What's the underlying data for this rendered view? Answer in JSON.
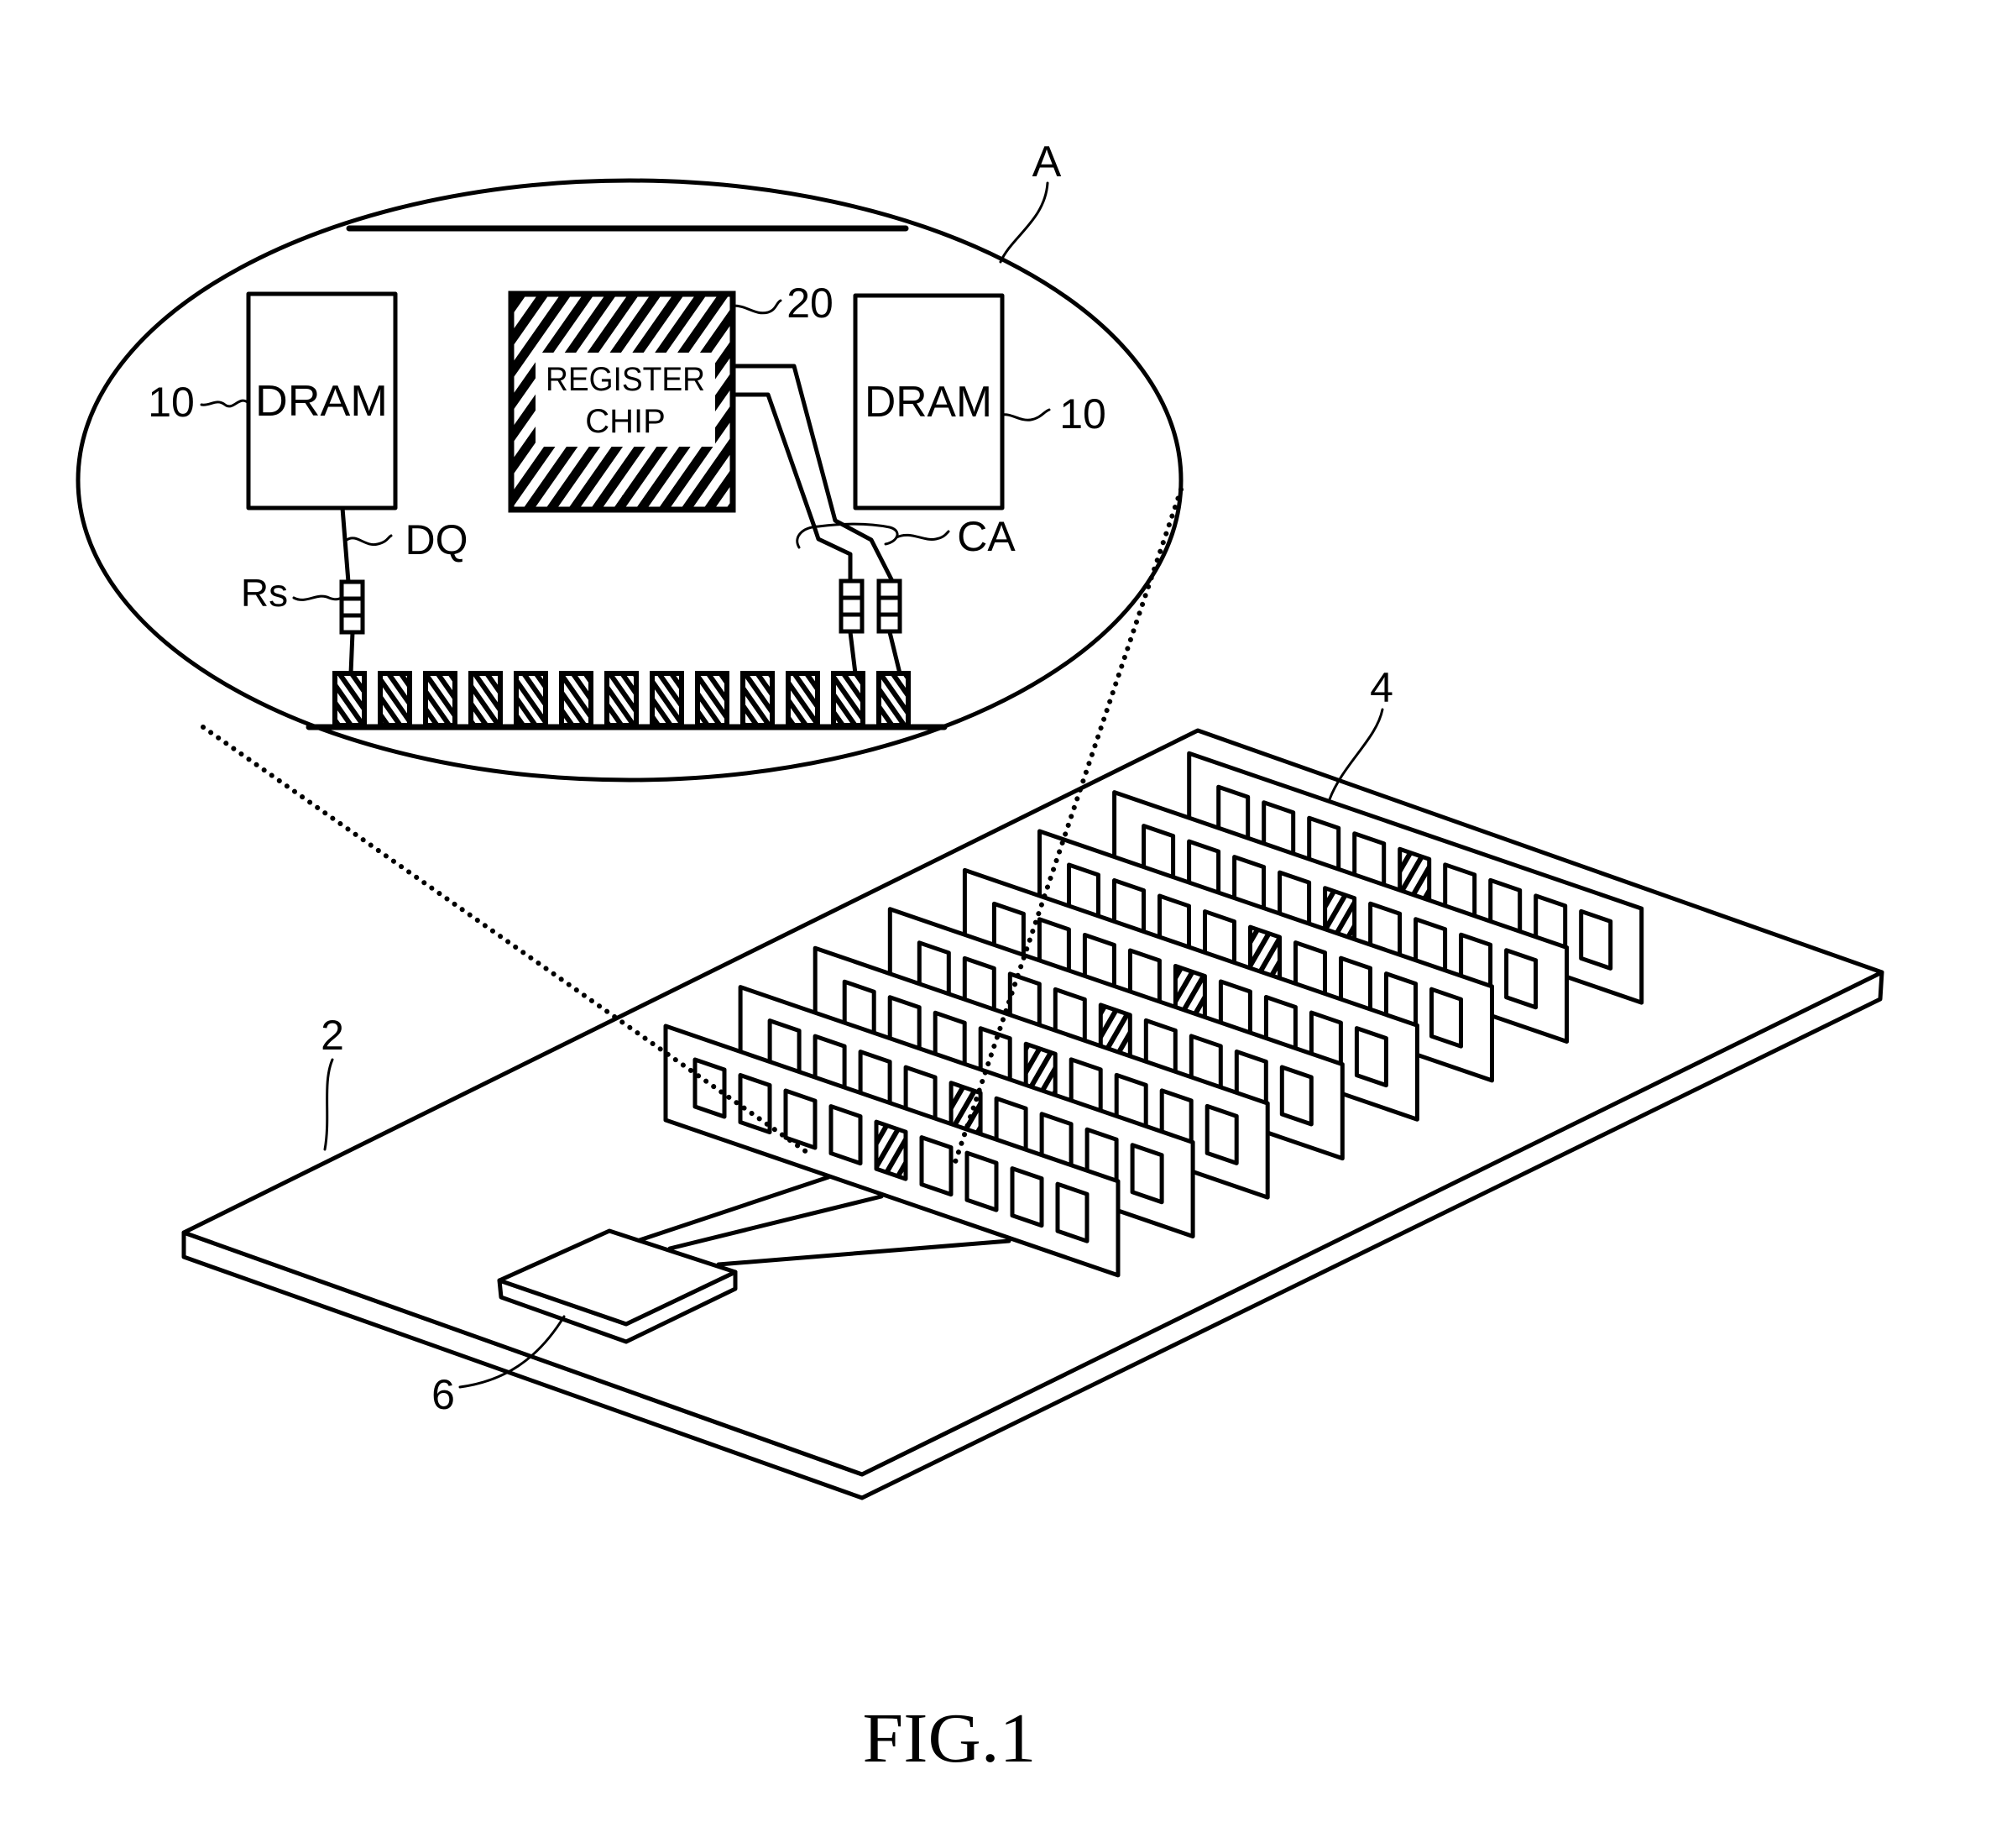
{
  "figure": {
    "caption": "FIG.1",
    "colors": {
      "ink": "#000000",
      "paper": "#ffffff"
    }
  },
  "callout": {
    "label": "A",
    "left_dram": {
      "text": "DRAM",
      "ref": "10"
    },
    "right_dram": {
      "text": "DRAM",
      "ref": "10"
    },
    "register_chip": {
      "line1": "REGISTER",
      "line2": "CHIP",
      "ref": "20"
    },
    "dq_label": "DQ",
    "rs_label": "Rs",
    "ca_label": "CA",
    "terminal_pins": {
      "count": 13,
      "connected": [
        0,
        11,
        12
      ]
    },
    "resistors": {
      "count": 3,
      "cells_each": 3
    }
  },
  "board": {
    "ref": "2",
    "modules": {
      "ref": "4",
      "count": 8,
      "chips_per_module": 9,
      "register_chip_index": 4
    },
    "controller": {
      "ref": "6"
    },
    "controller_links": 3
  }
}
